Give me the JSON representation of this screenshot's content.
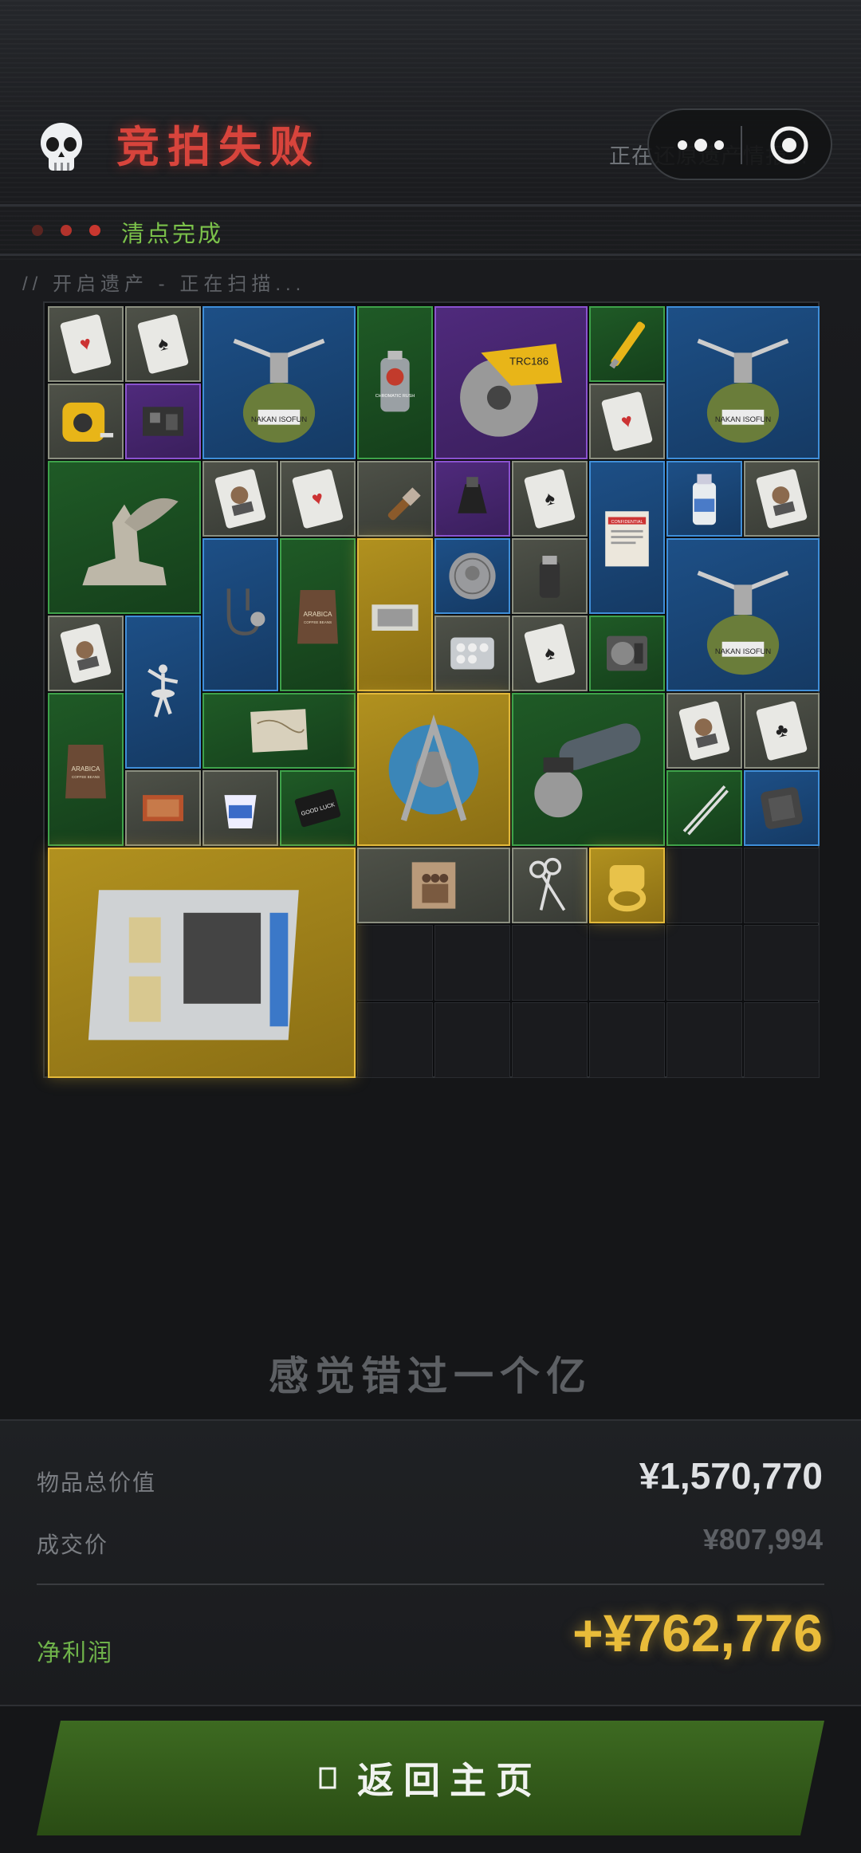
{
  "header": {
    "title": "竞拍失败",
    "subtitle": "正在还原遗产情报...",
    "status": "清点完成",
    "scan": "// 开启遗产 - 正在扫描..."
  },
  "icons": {
    "title_icon": "skull-icon",
    "capsule_more": "more-dots-icon",
    "capsule_close": "target-close-icon",
    "home": "home-icon"
  },
  "inventory": {
    "item_names": [
      "playing-card-hearts",
      "playing-card-spades",
      "camping-gas-stove",
      "spray-paint-can",
      "circular-saw",
      "voltage-tester-pen",
      "camping-gas-stove",
      "tape-measure",
      "circuit-module",
      "playing-card-hearts",
      "sphinx-statue",
      "playing-card-portrait",
      "playing-card-hearts",
      "paint-brush",
      "cable-clamp",
      "playing-card-spades",
      "confidential-document",
      "medicine-bottle",
      "playing-card-portrait",
      "stethoscope",
      "coffee-bean-bag",
      "old-photo",
      "ancient-coin",
      "salt-shaker",
      "camping-gas-stove",
      "playing-card-portrait",
      "ballerina-figurine",
      "pill-blister",
      "playing-card-spades",
      "hard-drive",
      "coffee-bean-bag",
      "old-map",
      "cable-reel",
      "angle-grinder",
      "playing-card-portrait",
      "playing-card-clubs",
      "matchbox",
      "yogurt-cup",
      "good-luck-card",
      "tweezers",
      "power-bank",
      "server-motherboard",
      "family-photo",
      "scissors",
      "gold-ring"
    ],
    "rarity_colors": {
      "white": "#8b8f80",
      "green": "#3ea24a",
      "blue": "#3f8ed8",
      "purple": "#8a52cf",
      "gold": "#e3b93a"
    },
    "item_labels": {
      "confidential": "CONFIDENTIAL",
      "coffee": "ARABICA",
      "coffee_sub": "COFFEE BEANS",
      "good_luck": "GOOD LUCK",
      "saw_model": "TRC186",
      "spray": "CHROMATIC RUSH",
      "stove": "NAKAN ISOFUN"
    }
  },
  "result": {
    "tagline": "感觉错过一个亿",
    "total_label": "物品总价值",
    "total_value": "¥1,570,770",
    "deal_label": "成交价",
    "deal_value": "¥807,994",
    "profit_label": "净利润",
    "profit_value": "+¥762,776"
  },
  "actions": {
    "home_label": "返回主页"
  },
  "colors": {
    "title_red": "#d8443c",
    "status_green": "#7bc24a",
    "profit_gold": "#e9bc3a",
    "button_green": "#3d6a21"
  }
}
